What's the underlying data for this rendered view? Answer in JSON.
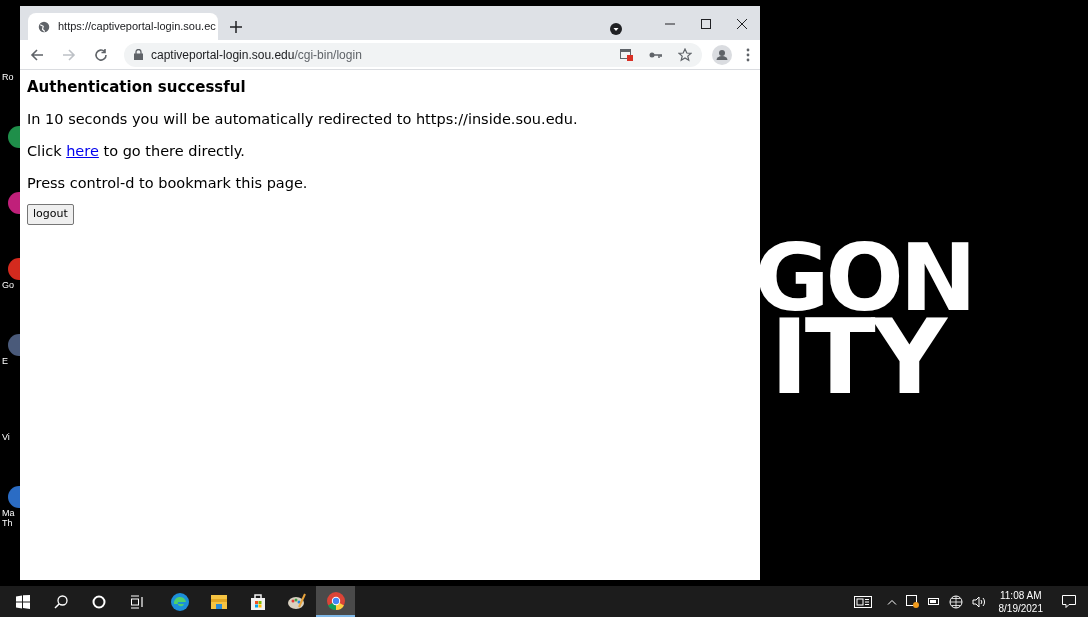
{
  "desktop": {
    "wallpaper_text": [
      "GON",
      "ITY"
    ],
    "icons": [
      {
        "label": "Ro"
      },
      {
        "color": "#1f8f4a"
      },
      {
        "color": "#c0207a"
      },
      {
        "label": "Go",
        "color": "#d42a1e"
      },
      {
        "label": "E",
        "color": "#4a5a7a"
      },
      {
        "label": "Vi"
      },
      {
        "label": "Ma\nTh",
        "color": "#2b6cc4"
      }
    ]
  },
  "browser": {
    "tab": {
      "title": "https://captiveportal-login.sou.ec",
      "selected": true
    },
    "address": {
      "domain": "captiveportal-login.sou.edu",
      "path": "/cgi-bin/login"
    }
  },
  "page": {
    "heading": "Authentication successful",
    "paragraphs": [
      {
        "kind": "text",
        "text": "In 10 seconds you will be automatically redirected to https://inside.sou.edu."
      },
      {
        "kind": "link",
        "before": "Click ",
        "link": "here",
        "after": " to go there directly."
      },
      {
        "kind": "text",
        "text": "Press control-d to bookmark this page."
      }
    ],
    "button": "logout"
  },
  "taskbar": {
    "apps": [
      {
        "kind": "edge",
        "selected": false
      },
      {
        "kind": "explorer",
        "selected": false
      },
      {
        "kind": "store",
        "selected": false
      },
      {
        "kind": "paint",
        "selected": false
      },
      {
        "kind": "chrome",
        "selected": true
      }
    ],
    "time": "11:08 AM",
    "date": "8/19/2021"
  }
}
